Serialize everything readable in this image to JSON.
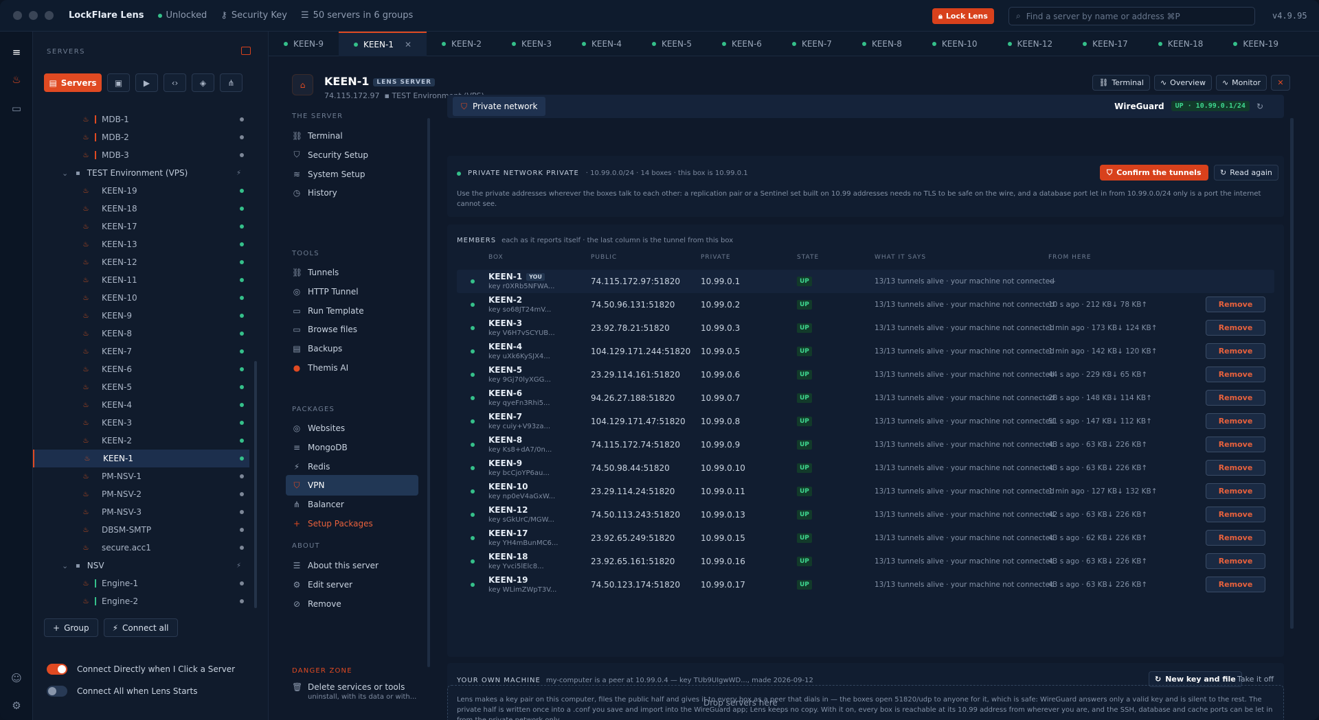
{
  "app": {
    "name": "LockFlare Lens",
    "status": "Unlocked",
    "security": "Security Key",
    "servers_count": "50 servers in 6 groups",
    "lock_label": "Lock Lens",
    "search_placeholder": "Find a server by name or address ⌘P",
    "version": "v4.9.95"
  },
  "sidebar": {
    "heading": "SERVERS",
    "servers_btn": "Servers",
    "tree": [
      {
        "label": "MDB-1",
        "kind": "server",
        "bar": "#e04a22",
        "status": "#7d8797"
      },
      {
        "label": "MDB-2",
        "kind": "server",
        "bar": "#e04a22",
        "status": "#7d8797"
      },
      {
        "label": "MDB-3",
        "kind": "server",
        "bar": "#e04a22",
        "status": "#7d8797"
      },
      {
        "label": "TEST Environment (VPS)",
        "kind": "group"
      },
      {
        "label": "KEEN-19",
        "kind": "server",
        "status": "#35c08a"
      },
      {
        "label": "KEEN-18",
        "kind": "server",
        "status": "#35c08a"
      },
      {
        "label": "KEEN-17",
        "kind": "server",
        "status": "#35c08a"
      },
      {
        "label": "KEEN-13",
        "kind": "server",
        "status": "#35c08a"
      },
      {
        "label": "KEEN-12",
        "kind": "server",
        "status": "#35c08a"
      },
      {
        "label": "KEEN-11",
        "kind": "server",
        "status": "#35c08a"
      },
      {
        "label": "KEEN-10",
        "kind": "server",
        "status": "#35c08a"
      },
      {
        "label": "KEEN-9",
        "kind": "server",
        "status": "#35c08a"
      },
      {
        "label": "KEEN-8",
        "kind": "server",
        "status": "#35c08a"
      },
      {
        "label": "KEEN-7",
        "kind": "server",
        "status": "#35c08a"
      },
      {
        "label": "KEEN-6",
        "kind": "server",
        "status": "#35c08a"
      },
      {
        "label": "KEEN-5",
        "kind": "server",
        "status": "#35c08a"
      },
      {
        "label": "KEEN-4",
        "kind": "server",
        "status": "#35c08a"
      },
      {
        "label": "KEEN-3",
        "kind": "server",
        "status": "#35c08a"
      },
      {
        "label": "KEEN-2",
        "kind": "server",
        "status": "#35c08a"
      },
      {
        "label": "KEEN-1",
        "kind": "server",
        "status": "#35c08a",
        "selected": true
      },
      {
        "label": "PM-NSV-1",
        "kind": "server",
        "status": "#7d8797"
      },
      {
        "label": "PM-NSV-2",
        "kind": "server",
        "status": "#7d8797"
      },
      {
        "label": "PM-NSV-3",
        "kind": "server",
        "status": "#7d8797"
      },
      {
        "label": "DBSM-SMTP",
        "kind": "server",
        "status": "#7d8797"
      },
      {
        "label": "secure.acc1",
        "kind": "server",
        "status": "#7d8797"
      },
      {
        "label": "NSV",
        "kind": "group"
      },
      {
        "label": "Engine-1",
        "kind": "server",
        "bar": "#35c08a",
        "status": "#7d8797"
      },
      {
        "label": "Engine-2",
        "kind": "server",
        "bar": "#35c08a",
        "status": "#7d8797"
      }
    ],
    "group_btn": "Group",
    "connect_all_btn": "Connect all",
    "toggle1": "Connect Directly when I Click a Server",
    "toggle2": "Connect All when Lens Starts"
  },
  "tabs": [
    "KEEN-9",
    "KEEN-1",
    "KEEN-2",
    "KEEN-3",
    "KEEN-4",
    "KEEN-5",
    "KEEN-6",
    "KEEN-7",
    "KEEN-8",
    "KEEN-10",
    "KEEN-12",
    "KEEN-17",
    "KEEN-18",
    "KEEN-19"
  ],
  "server": {
    "name": "KEEN-1",
    "badge": "LENS SERVER",
    "ip": "74.115.172.97",
    "env": "TEST Environment (VPS)",
    "btn_terminal": "Terminal",
    "btn_overview": "Overview",
    "btn_monitor": "Monitor"
  },
  "subnav": {
    "the_server": "THE SERVER",
    "tools": "TOOLS",
    "packages": "PACKAGES",
    "about": "ABOUT",
    "danger": "DANGER ZONE",
    "server_items": [
      "Terminal",
      "Security Setup",
      "System Setup",
      "History"
    ],
    "tool_items": [
      "Tunnels",
      "HTTP Tunnel",
      "Run Template",
      "Browse files",
      "Backups",
      "Themis AI"
    ],
    "package_items": [
      "Websites",
      "MongoDB",
      "Redis",
      "VPN",
      "Balancer",
      "Setup Packages"
    ],
    "about_items": [
      "About this server",
      "Edit server",
      "Remove"
    ],
    "danger_title": "Delete services or tools",
    "danger_sub": "uninstall, with its data or with..."
  },
  "vpn": {
    "tab": "Private network",
    "wg": "WireGuard",
    "wg_status": "UP · 10.99.0.1/24",
    "pv_title": "PRIVATE NETWORK PRIVATE",
    "pv_meta": "· 10.99.0.0/24 · 14 boxes · this box is 10.99.0.1",
    "confirm": "Confirm the tunnels",
    "read_again": "Read again",
    "pv_desc": "Use the private addresses wherever the boxes talk to each other: a replication pair or a Sentinel set built on 10.99 addresses needs no TLS to be safe on the wire, and a database port let in from 10.99.0.0/24 only is a port the internet cannot see.",
    "members_title": "MEMBERS",
    "members_sub": "each as it reports itself · the last column is the tunnel from this box",
    "cols": [
      "BOX",
      "PUBLIC",
      "PRIVATE",
      "STATE",
      "WHAT IT SAYS",
      "FROM HERE"
    ],
    "you": "YOU",
    "remove": "Remove",
    "members": [
      {
        "box": "KEEN-1",
        "key": "key r0XRb5NFWA...",
        "public": "74.115.172.97:51820",
        "private": "10.99.0.1",
        "state": "UP",
        "says": "13/13 tunnels alive · your machine not connected",
        "from": "—",
        "me": true
      },
      {
        "box": "KEEN-2",
        "key": "key so68JT24mV...",
        "public": "74.50.96.131:51820",
        "private": "10.99.0.2",
        "state": "UP",
        "says": "13/13 tunnels alive · your machine not connected",
        "from": "10 s ago · 212 KB↓ 78 KB↑"
      },
      {
        "box": "KEEN-3",
        "key": "key V6H7vSCYUB...",
        "public": "23.92.78.21:51820",
        "private": "10.99.0.3",
        "state": "UP",
        "says": "13/13 tunnels alive · your machine not connected",
        "from": "1 min ago · 173 KB↓ 124 KB↑"
      },
      {
        "box": "KEEN-4",
        "key": "key uXk6KySJX4...",
        "public": "104.129.171.244:51820",
        "private": "10.99.0.5",
        "state": "UP",
        "says": "13/13 tunnels alive · your machine not connected",
        "from": "1 min ago · 142 KB↓ 120 KB↑"
      },
      {
        "box": "KEEN-5",
        "key": "key 9Gj70lyXGG...",
        "public": "23.29.114.161:51820",
        "private": "10.99.0.6",
        "state": "UP",
        "says": "13/13 tunnels alive · your machine not connected",
        "from": "44 s ago · 229 KB↓ 65 KB↑"
      },
      {
        "box": "KEEN-6",
        "key": "key qyeFn3Rhi5...",
        "public": "94.26.27.188:51820",
        "private": "10.99.0.7",
        "state": "UP",
        "says": "13/13 tunnels alive · your machine not connected",
        "from": "28 s ago · 148 KB↓ 114 KB↑"
      },
      {
        "box": "KEEN-7",
        "key": "key cuiy+V93za...",
        "public": "104.129.171.47:51820",
        "private": "10.99.0.8",
        "state": "UP",
        "says": "13/13 tunnels alive · your machine not connected",
        "from": "51 s ago · 147 KB↓ 112 KB↑"
      },
      {
        "box": "KEEN-8",
        "key": "key Ks8+dA7/0n...",
        "public": "74.115.172.74:51820",
        "private": "10.99.0.9",
        "state": "UP",
        "says": "13/13 tunnels alive · your machine not connected",
        "from": "43 s ago · 63 KB↓ 226 KB↑"
      },
      {
        "box": "KEEN-9",
        "key": "key bcCjoYP6au...",
        "public": "74.50.98.44:51820",
        "private": "10.99.0.10",
        "state": "UP",
        "says": "13/13 tunnels alive · your machine not connected",
        "from": "43 s ago · 63 KB↓ 226 KB↑"
      },
      {
        "box": "KEEN-10",
        "key": "key np0eV4aGxW...",
        "public": "23.29.114.24:51820",
        "private": "10.99.0.11",
        "state": "UP",
        "says": "13/13 tunnels alive · your machine not connected",
        "from": "1 min ago · 127 KB↓ 132 KB↑"
      },
      {
        "box": "KEEN-12",
        "key": "key sGkUrC/MGW...",
        "public": "74.50.113.243:51820",
        "private": "10.99.0.13",
        "state": "UP",
        "says": "13/13 tunnels alive · your machine not connected",
        "from": "42 s ago · 63 KB↓ 226 KB↑"
      },
      {
        "box": "KEEN-17",
        "key": "key YH4mBunMC6...",
        "public": "23.92.65.249:51820",
        "private": "10.99.0.15",
        "state": "UP",
        "says": "13/13 tunnels alive · your machine not connected",
        "from": "43 s ago · 62 KB↓ 226 KB↑"
      },
      {
        "box": "KEEN-18",
        "key": "key Yvci5lElc8...",
        "public": "23.92.65.161:51820",
        "private": "10.99.0.16",
        "state": "UP",
        "says": "13/13 tunnels alive · your machine not connected",
        "from": "43 s ago · 63 KB↓ 226 KB↑"
      },
      {
        "box": "KEEN-19",
        "key": "key WLimZWpT3V...",
        "public": "74.50.123.174:51820",
        "private": "10.99.0.17",
        "state": "UP",
        "says": "13/13 tunnels alive · your machine not connected",
        "from": "43 s ago · 63 KB↓ 226 KB↑"
      }
    ],
    "own_title": "YOUR OWN MACHINE",
    "own_meta": "my-computer is a peer at 10.99.0.4 — key TUb9UIgwWD..., made 2026-09-12",
    "new_key": "New key and file",
    "take_off": "Take it off",
    "own_desc": "Lens makes a key pair on this computer, files the public half and gives it to every box as a peer that dials in — the boxes open 51820/udp to anyone for it, which is safe: WireGuard answers only a valid key and is silent to the rest. The private half is written once into a .conf you save and import into the WireGuard app; Lens keeps no copy. With it on, every box is reachable at its 10.99 address from wherever you are, and the SSH, database and cache ports can be let in from the private network only.",
    "drop": "Drop servers here"
  }
}
